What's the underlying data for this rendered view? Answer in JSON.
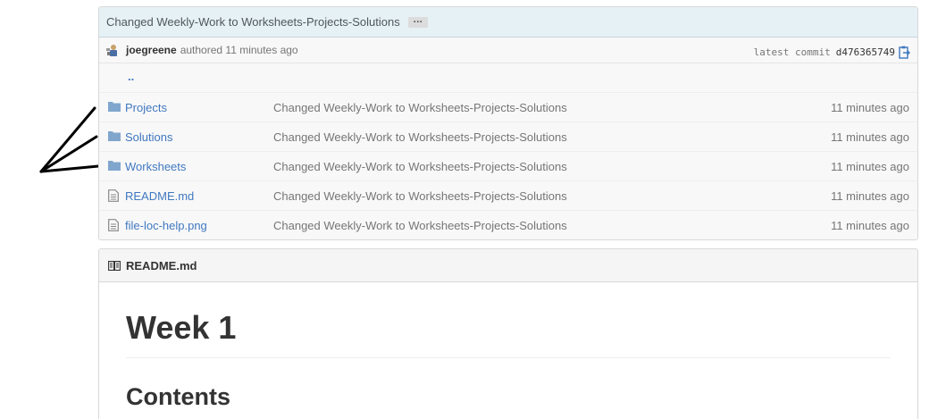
{
  "commit_tease": {
    "message": "Changed Weekly-Work to Worksheets-Projects-Solutions",
    "ellipsis": "…"
  },
  "commit_meta": {
    "author": "joegreene",
    "authored_label": "authored",
    "authored_time": "11 minutes ago",
    "latest_commit_label": "latest commit",
    "sha": "d476365749"
  },
  "files": {
    "up_link": "..",
    "items": [
      {
        "type": "directory",
        "name": "Projects",
        "message": "Changed Weekly-Work to Worksheets-Projects-Solutions",
        "age": "11 minutes ago"
      },
      {
        "type": "directory",
        "name": "Solutions",
        "message": "Changed Weekly-Work to Worksheets-Projects-Solutions",
        "age": "11 minutes ago"
      },
      {
        "type": "directory",
        "name": "Worksheets",
        "message": "Changed Weekly-Work to Worksheets-Projects-Solutions",
        "age": "11 minutes ago"
      },
      {
        "type": "file",
        "name": "README.md",
        "message": "Changed Weekly-Work to Worksheets-Projects-Solutions",
        "age": "11 minutes ago"
      },
      {
        "type": "file",
        "name": "file-loc-help.png",
        "message": "Changed Weekly-Work to Worksheets-Projects-Solutions",
        "age": "11 minutes ago"
      }
    ]
  },
  "readme": {
    "filename": "README.md",
    "h1": "Week 1",
    "h2": "Contents"
  },
  "colors": {
    "link": "#4078c0",
    "folder_icon": "#80a6cd",
    "commit_tease_bg": "#e6f1f6",
    "muted_text": "#767676",
    "annotation": "#000000"
  },
  "icons": {
    "directory": "folder-icon",
    "file": "file-text-icon",
    "readme": "book-icon",
    "clipboard": "clipboard-icon",
    "avatar": "avatar",
    "annotation": "hand-drawn-arrow-icon"
  }
}
